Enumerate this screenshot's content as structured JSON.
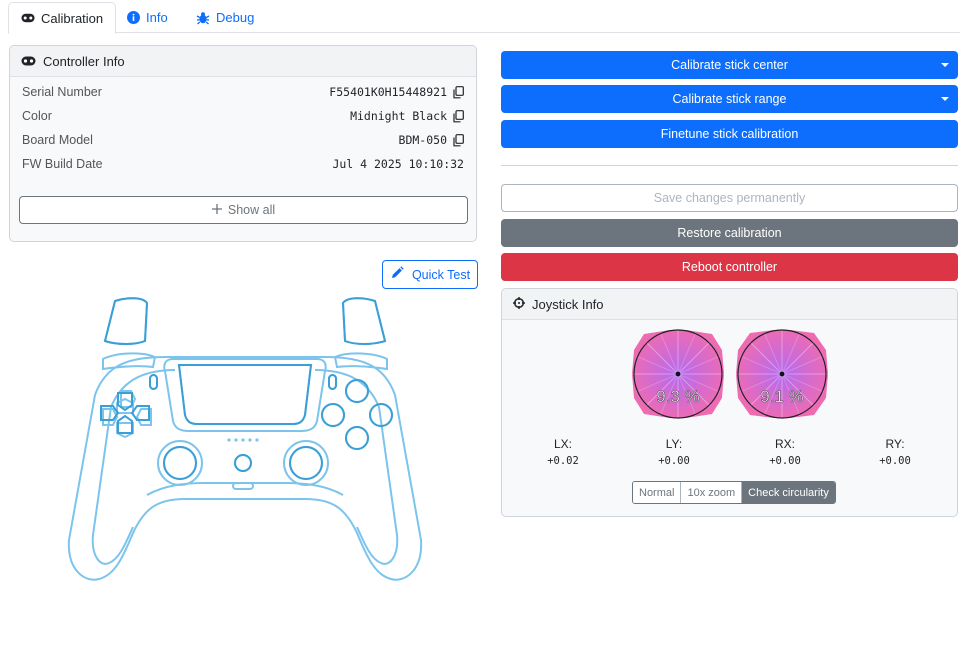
{
  "tabs": [
    {
      "label": "Calibration",
      "icon": "gamepad-icon"
    },
    {
      "label": "Info",
      "icon": "info-icon"
    },
    {
      "label": "Debug",
      "icon": "bug-icon"
    }
  ],
  "controller_info": {
    "title": "Controller Info",
    "rows": [
      {
        "label": "Serial Number",
        "value": "F55401K0H15448921"
      },
      {
        "label": "Color",
        "value": "Midnight Black"
      },
      {
        "label": "Board Model",
        "value": "BDM-050"
      },
      {
        "label": "FW Build Date",
        "value": "Jul 4 2025 10:10:32"
      }
    ],
    "show_all": "Show all"
  },
  "quick_test": "Quick Test",
  "actions": {
    "calibrate_center": "Calibrate stick center",
    "calibrate_range": "Calibrate stick range",
    "finetune": "Finetune stick calibration",
    "save": "Save changes permanently",
    "restore": "Restore calibration",
    "reboot": "Reboot controller"
  },
  "joystick": {
    "title": "Joystick Info",
    "left_pct": "9.3 %",
    "right_pct": "9.1 %",
    "axes": [
      {
        "label": "LX:",
        "value": "+0.02"
      },
      {
        "label": "LY:",
        "value": "+0.00"
      },
      {
        "label": "RX:",
        "value": "+0.00"
      },
      {
        "label": "RY:",
        "value": "+0.00"
      }
    ],
    "modes": [
      "Normal",
      "10x zoom",
      "Check circularity"
    ],
    "active_mode": "Check circularity"
  },
  "colors": {
    "primary": "#0d6efd",
    "secondary": "#6c757d",
    "danger": "#dc3545",
    "controller_outline": "#7cc4ec"
  }
}
